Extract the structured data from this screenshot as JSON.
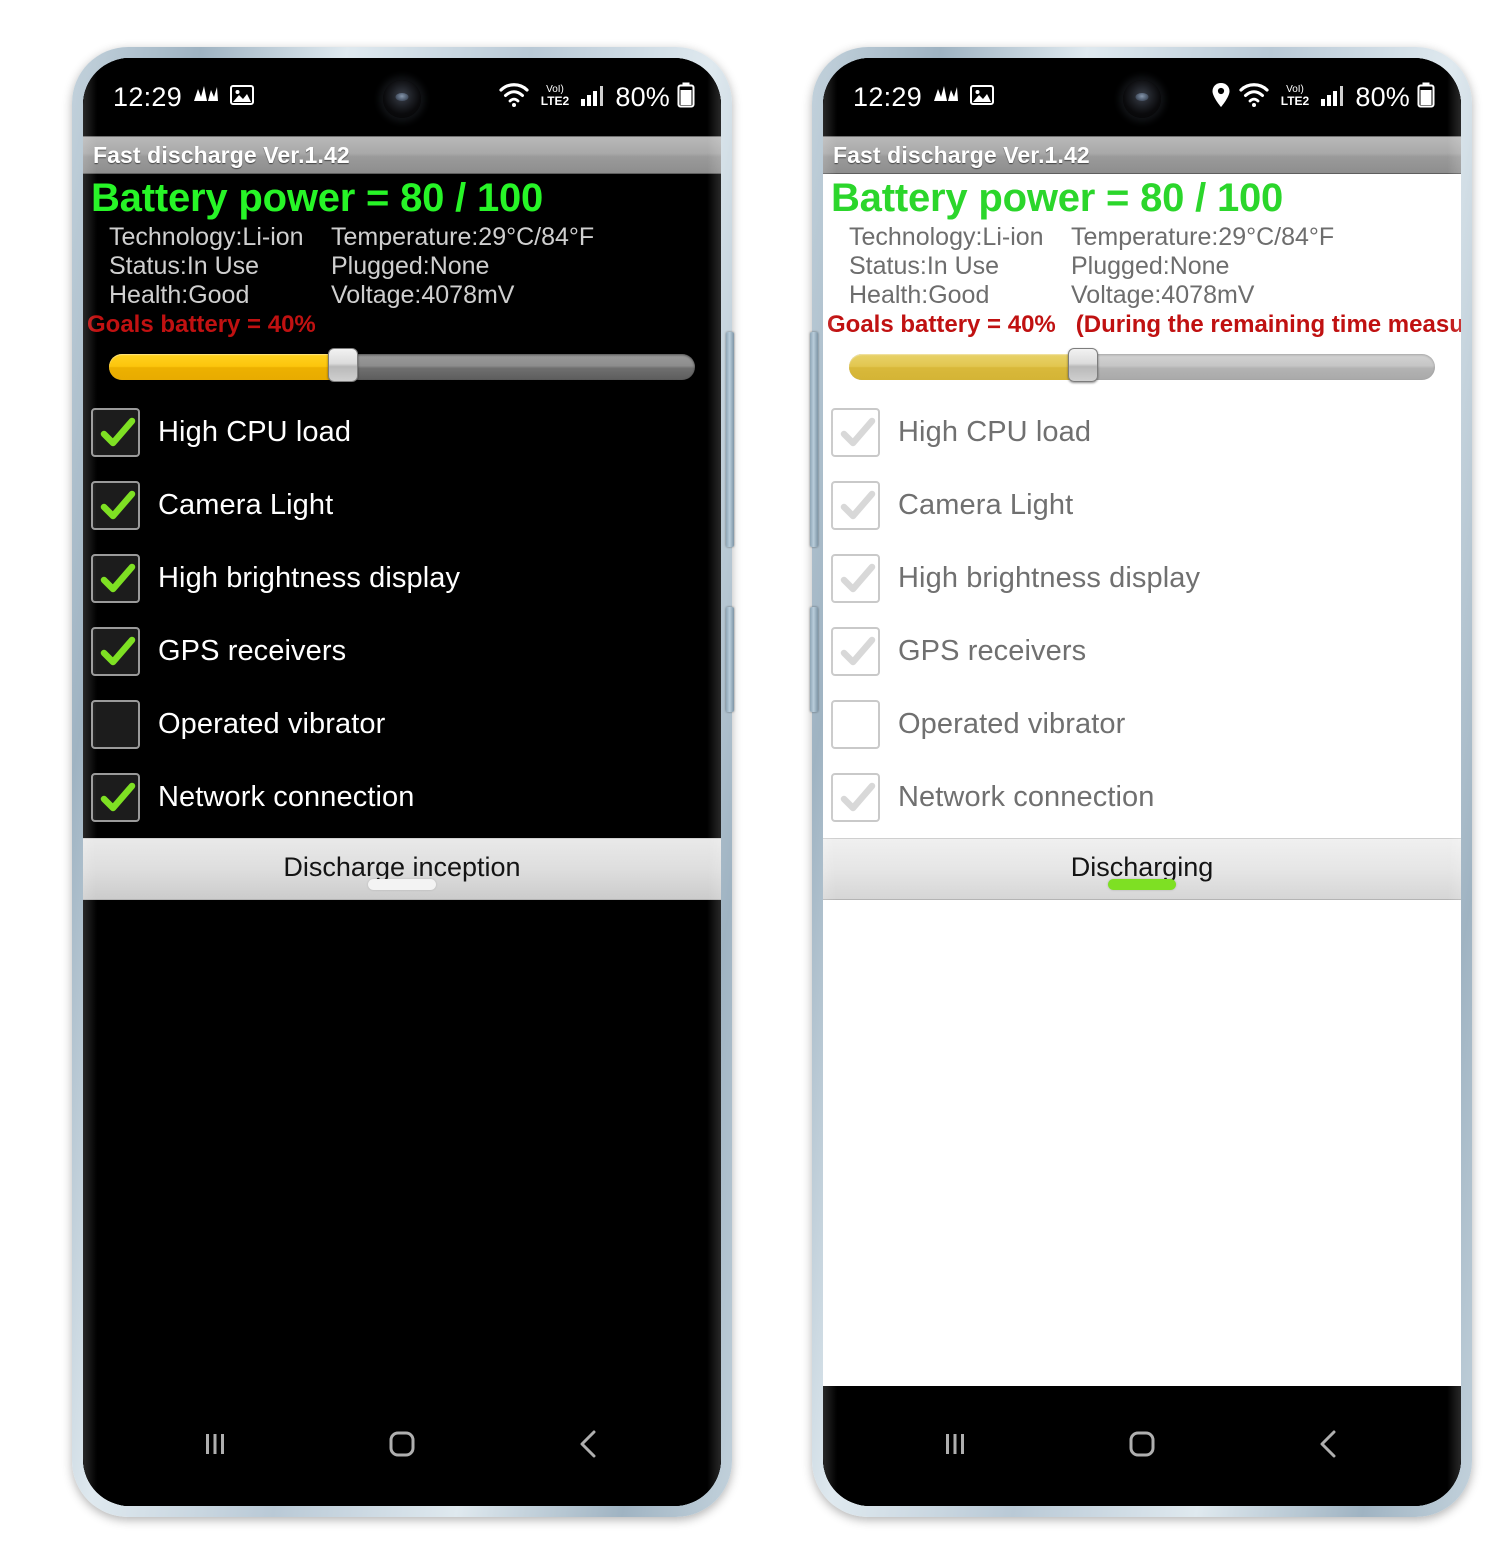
{
  "statusbar": {
    "time": "12:29",
    "battery_percent": "80%",
    "icons_left": [
      "chart-icon",
      "image-icon"
    ],
    "icons_right_common": [
      "wifi-icon",
      "volte2-icon",
      "signal-bars-icon",
      "battery-icon"
    ],
    "icons_right_extra_phone2": [
      "location-pin-icon"
    ],
    "network_label": "LTE2",
    "volte_label": "VoI)"
  },
  "app": {
    "title": "Fast discharge  Ver.1.42",
    "battery_power_line": "Battery power = 80 / 100",
    "info": [
      {
        "left": "Technology:Li-ion",
        "right": "Temperature:29°C/84°F"
      },
      {
        "left": "Status:In Use",
        "right": "Plugged:None"
      },
      {
        "left": "Health:Good",
        "right": "Voltage:4078mV"
      }
    ],
    "goals_label": "Goals battery = 40%",
    "goals_note": "(During the remaining time measurement)",
    "slider": {
      "value_percent": 40,
      "min": 0,
      "max": 100
    },
    "checkboxes": [
      {
        "label": "High CPU load",
        "checked": true
      },
      {
        "label": "Camera Light",
        "checked": true
      },
      {
        "label": "High brightness display",
        "checked": true
      },
      {
        "label": "GPS receivers",
        "checked": true
      },
      {
        "label": "Operated vibrator",
        "checked": false
      },
      {
        "label": "Network connection",
        "checked": true
      }
    ]
  },
  "phone_left": {
    "theme": "dark",
    "action_button_label": "Discharge inception",
    "action_underline_color": "#f3f3f3",
    "controls_enabled": true,
    "goals_note_visible": false
  },
  "phone_right": {
    "theme": "light",
    "action_button_label": "Discharging",
    "action_underline_color": "#7ee023",
    "controls_enabled": false,
    "goals_note_visible": true
  },
  "navbar": {
    "recents_label": "|||",
    "home_label": "○",
    "back_label": "‹"
  },
  "colors": {
    "battery_green_dark": "#27f527",
    "battery_green_light": "#2bd62b",
    "goals_red": "#c01111",
    "slider_fill_active": "#fcc50c",
    "slider_fill_disabled": "#e2c64f",
    "check_green": "#7ee023",
    "check_grey": "#d8d8d8",
    "frame_blue": "#b9c9d6"
  }
}
